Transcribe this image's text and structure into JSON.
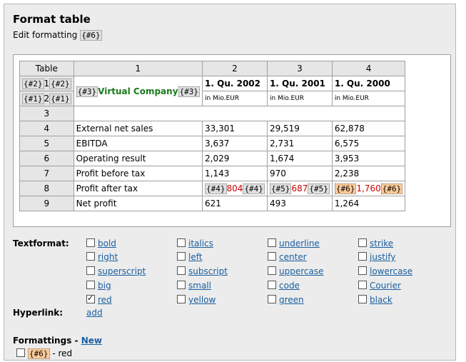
{
  "header": {
    "title": "Format table",
    "subtitle": "Edit formatting",
    "subtitle_tag": "{#6}"
  },
  "table": {
    "corner": "Table",
    "col_headers": [
      "1",
      "2",
      "3",
      "4"
    ],
    "row1": {
      "tag_a1": "{#2}",
      "num_a": "1",
      "tag_a2": "{#2}",
      "tag_b1": "{#1}",
      "num_b": "2",
      "tag_b2": "{#1}",
      "company_tag1": "{#3}",
      "company": "Virtual Company",
      "company_tag2": "{#3}",
      "periods": [
        "1. Qu. 2002",
        "1. Qu. 2001",
        "1. Qu. 2000"
      ],
      "unit": "in Mio.EUR"
    },
    "rows": [
      {
        "num": "3",
        "label": "",
        "v": [
          "",
          "",
          ""
        ]
      },
      {
        "num": "4",
        "label": "External net sales",
        "v": [
          "33,301",
          "29,519",
          "62,878"
        ]
      },
      {
        "num": "5",
        "label": "EBITDA",
        "v": [
          "3,637",
          "2,731",
          "6,575"
        ]
      },
      {
        "num": "6",
        "label": "Operating result",
        "v": [
          "2,029",
          "1,674",
          "3,953"
        ]
      },
      {
        "num": "7",
        "label": "Profit before tax",
        "v": [
          "1,143",
          "970",
          "2,238"
        ]
      },
      {
        "num": "8",
        "label": "Profit after tax",
        "v": [
          "804",
          "687",
          "1,760"
        ],
        "tags": [
          "{#4}",
          "{#5}",
          "{#6}"
        ]
      },
      {
        "num": "9",
        "label": "Net profit",
        "v": [
          "621",
          "493",
          "1,264"
        ]
      }
    ]
  },
  "textformat": {
    "label": "Textformat:",
    "options": [
      [
        "bold",
        "italics",
        "underline",
        "strike"
      ],
      [
        "right",
        "left",
        "center",
        "justify"
      ],
      [
        "superscript",
        "subscript",
        "uppercase",
        "lowercase"
      ],
      [
        "big",
        "small",
        "code",
        "Courier"
      ],
      [
        "red",
        "yellow",
        "green",
        "black"
      ]
    ],
    "checked": "red"
  },
  "hyperlink": {
    "label": "Hyperlink:",
    "add": "add"
  },
  "formattings": {
    "label": "Formattings -",
    "new": "New",
    "item_tag": "{#6}",
    "item_text": "- red"
  }
}
